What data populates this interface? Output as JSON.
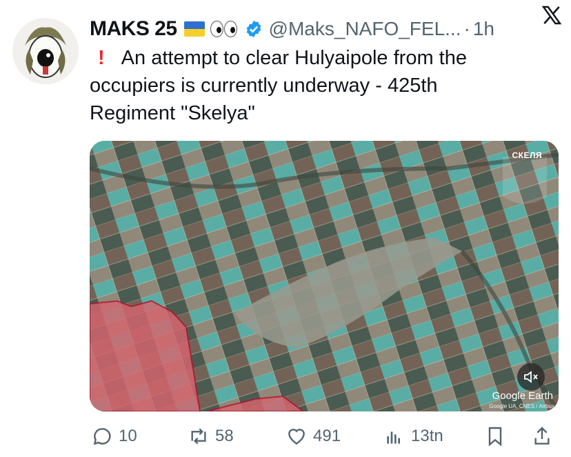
{
  "author": {
    "name": "MAKS 25",
    "handle": "@Maks_NAFO_FEL...",
    "time": "1h",
    "separator": "·"
  },
  "tweet": {
    "alert_mark": "!",
    "text_line1": "An attempt to clear Hulyaipole from the",
    "text_line2": "occupiers is currently underway - 425th",
    "text_line3": "Regiment \"Skelya\""
  },
  "media": {
    "badge_text": "СКЕЛЯ",
    "map_label": "Google Earth",
    "map_credit": "Google UA, CNES / Airbus",
    "mute_icon": "speaker-muted-icon"
  },
  "actions": {
    "replies": "10",
    "reposts": "58",
    "likes": "491",
    "views": "13tn"
  },
  "colors": {
    "accent": "#1d9bf0",
    "muted": "#536471",
    "alert": "#f4212e",
    "occupied_zone": "#d9646e"
  }
}
